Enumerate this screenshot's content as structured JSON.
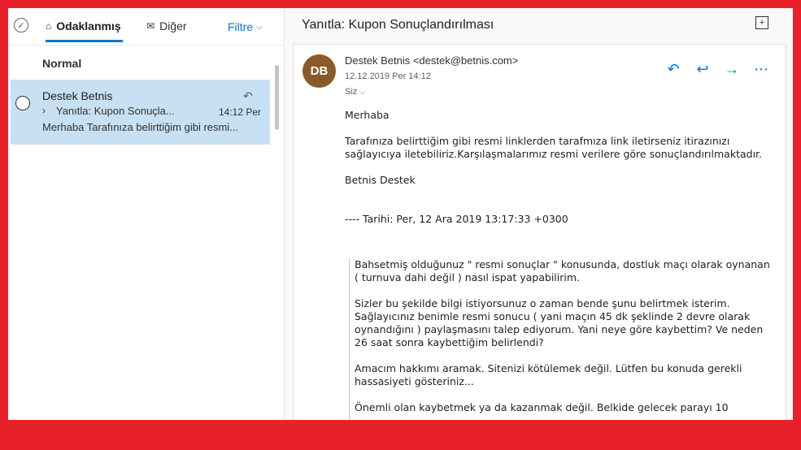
{
  "left": {
    "select_all_icon": "check-circle-icon",
    "tabs": [
      {
        "label": "Odaklanmış",
        "icon": "inbox-icon"
      },
      {
        "label": "Diğer",
        "icon": "mail-icon"
      }
    ],
    "filter_label": "Filtre",
    "group_header": "Normal",
    "items": [
      {
        "sender": "Destek Betnis",
        "subject": "Yanıtla: Kupon Sonuçla...",
        "time": "14:12 Per",
        "preview": "Merhaba Tarafınıza belirttiğim gibi resmi..."
      }
    ]
  },
  "reading": {
    "title": "Yanıtla: Kupon Sonuçlandırılması",
    "avatar_initials": "DB",
    "avatar_color": "#8b5a2b",
    "from": "Destek Betnis <destek@betnis.com>",
    "date": "12.12.2019 Per 14:12",
    "to": "Siz",
    "body": {
      "greeting": "Merhaba",
      "p1": " Tarafınıza belirttiğim gibi resmi linklerden tarafmıza link iletirseniz itirazınızı sağlayıcıya iletebiliriz.Karşılaşmalarımız resmi verilere göre sonuçlandırılmaktadır.",
      "signature": " Betnis Destek",
      "date_line": "---- Tarihi: Per, 12 Ara 2019 13:17:33 +0300"
    },
    "quote": {
      "q1": "Bahsetmiş olduğunuz \" resmi sonuçlar \" konusunda, dostluk maçı olarak oynanan ( turnuva dahi değil ) nasıl ispat yapabilirim.",
      "q2": "Sizler bu şekilde bilgi istiyorsunuz o zaman bende şunu belirtmek isterim. Sağlayıcınız benimle resmi sonucu ( yani maçın 45 dk şeklinde 2 devre olarak oynandığını ) paylaşmasını talep ediyorum. Yani neye göre kaybettim? Ve neden 26 saat sonra kaybettiğim belirlendi?",
      "q3": "Amacım hakkımı aramak. Sitenizi kötülemek değil. Lütfen bu konuda gerekli hassasiyeti gösteriniz...",
      "q4": "Önemli olan kaybetmek ya da kazanmak değil. Belkide gelecek parayı 10"
    }
  },
  "colors": {
    "accent": "#0078d4",
    "selected_item": "#c7e0f4",
    "frame_border": "#e8202a"
  }
}
